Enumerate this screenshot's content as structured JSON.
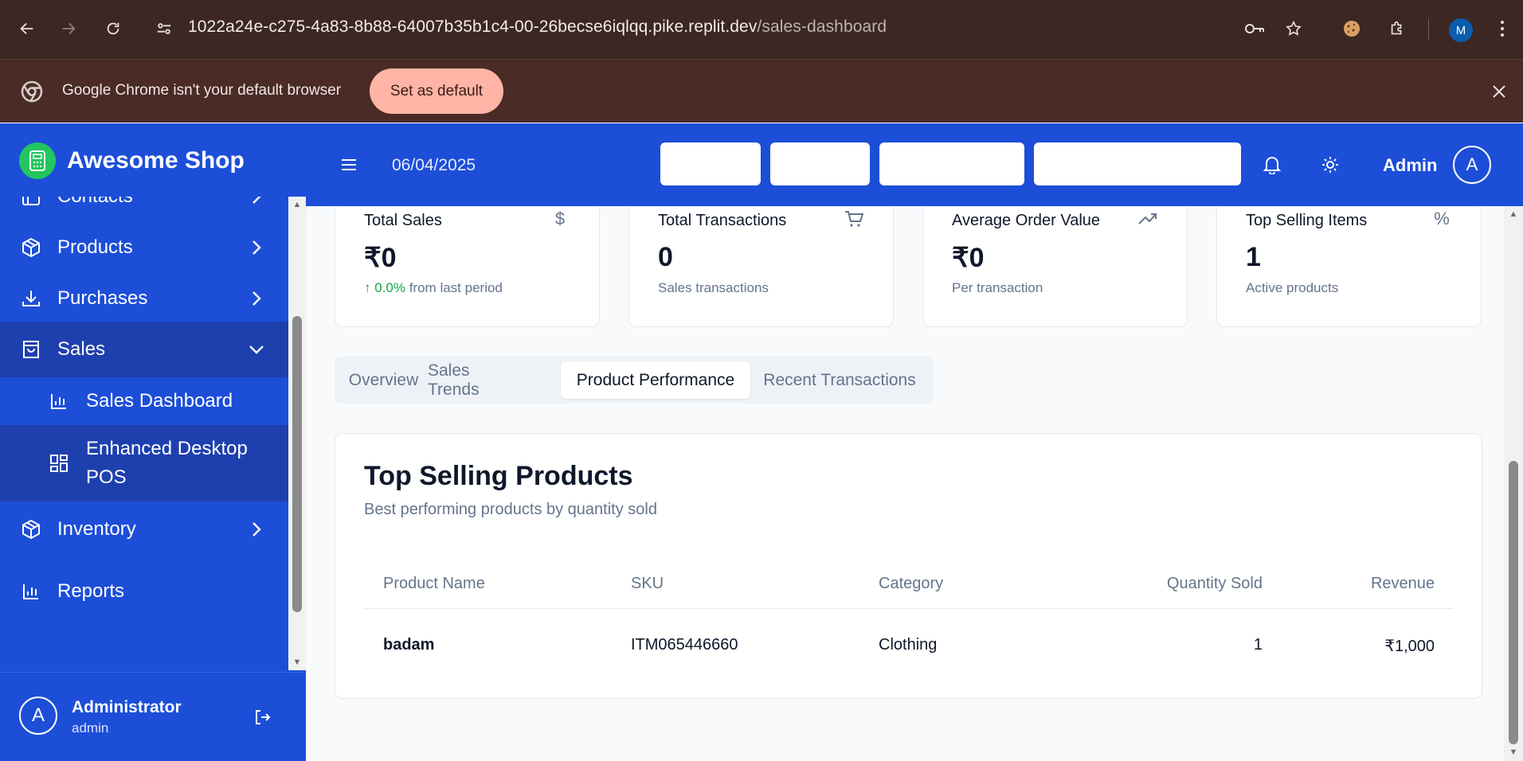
{
  "browser": {
    "url_main": "1022a24e-c275-4a83-8b88-64007b35b1c4-00-26becse6iqlqq.pike.replit.dev",
    "url_path": "/sales-dashboard",
    "profile_initial": "M",
    "infobar_message": "Google Chrome isn't your default browser",
    "set_default_label": "Set as default"
  },
  "brand": {
    "name": "Awesome Shop"
  },
  "sidebar": {
    "items": [
      {
        "label": "Contacts",
        "icon": "contacts-icon"
      },
      {
        "label": "Products",
        "icon": "package-icon"
      },
      {
        "label": "Purchases",
        "icon": "download-icon"
      },
      {
        "label": "Sales",
        "icon": "shopping-bag-icon"
      },
      {
        "label": "Inventory",
        "icon": "package-icon"
      },
      {
        "label": "Reports",
        "icon": "bar-chart-icon"
      }
    ],
    "sub_items": [
      {
        "label": "Sales Dashboard",
        "icon": "bar-chart-icon"
      },
      {
        "label_line1": "Enhanced Desktop",
        "label_line2": "POS",
        "icon": "grid-icon"
      }
    ]
  },
  "user": {
    "initial": "A",
    "name": "Administrator",
    "role": "admin"
  },
  "topbar": {
    "date": "06/04/2025",
    "admin_label": "Admin",
    "admin_initial": "A"
  },
  "cards": [
    {
      "title": "Total Sales",
      "icon": "dollar-icon",
      "value": "₹0",
      "change": "0.0%",
      "change_suffix": "from last period"
    },
    {
      "title": "Total Transactions",
      "icon": "cart-icon",
      "value": "0",
      "subtitle": "Sales transactions"
    },
    {
      "title": "Average Order Value",
      "icon": "trending-up-icon",
      "value": "₹0",
      "subtitle": "Per transaction"
    },
    {
      "title": "Top Selling Items",
      "icon": "percent-icon",
      "value": "1",
      "subtitle": "Active products"
    }
  ],
  "tabs": [
    "Overview",
    "Sales Trends",
    "Product Performance",
    "Recent Transactions"
  ],
  "active_tab": "Product Performance",
  "panel": {
    "title": "Top Selling Products",
    "subtitle": "Best performing products by quantity sold",
    "columns": [
      "Product Name",
      "SKU",
      "Category",
      "Quantity Sold",
      "Revenue"
    ],
    "rows": [
      {
        "name": "badam",
        "sku": "ITM065446660",
        "category": "Clothing",
        "qty": "1",
        "revenue": "₹1,000"
      }
    ]
  }
}
